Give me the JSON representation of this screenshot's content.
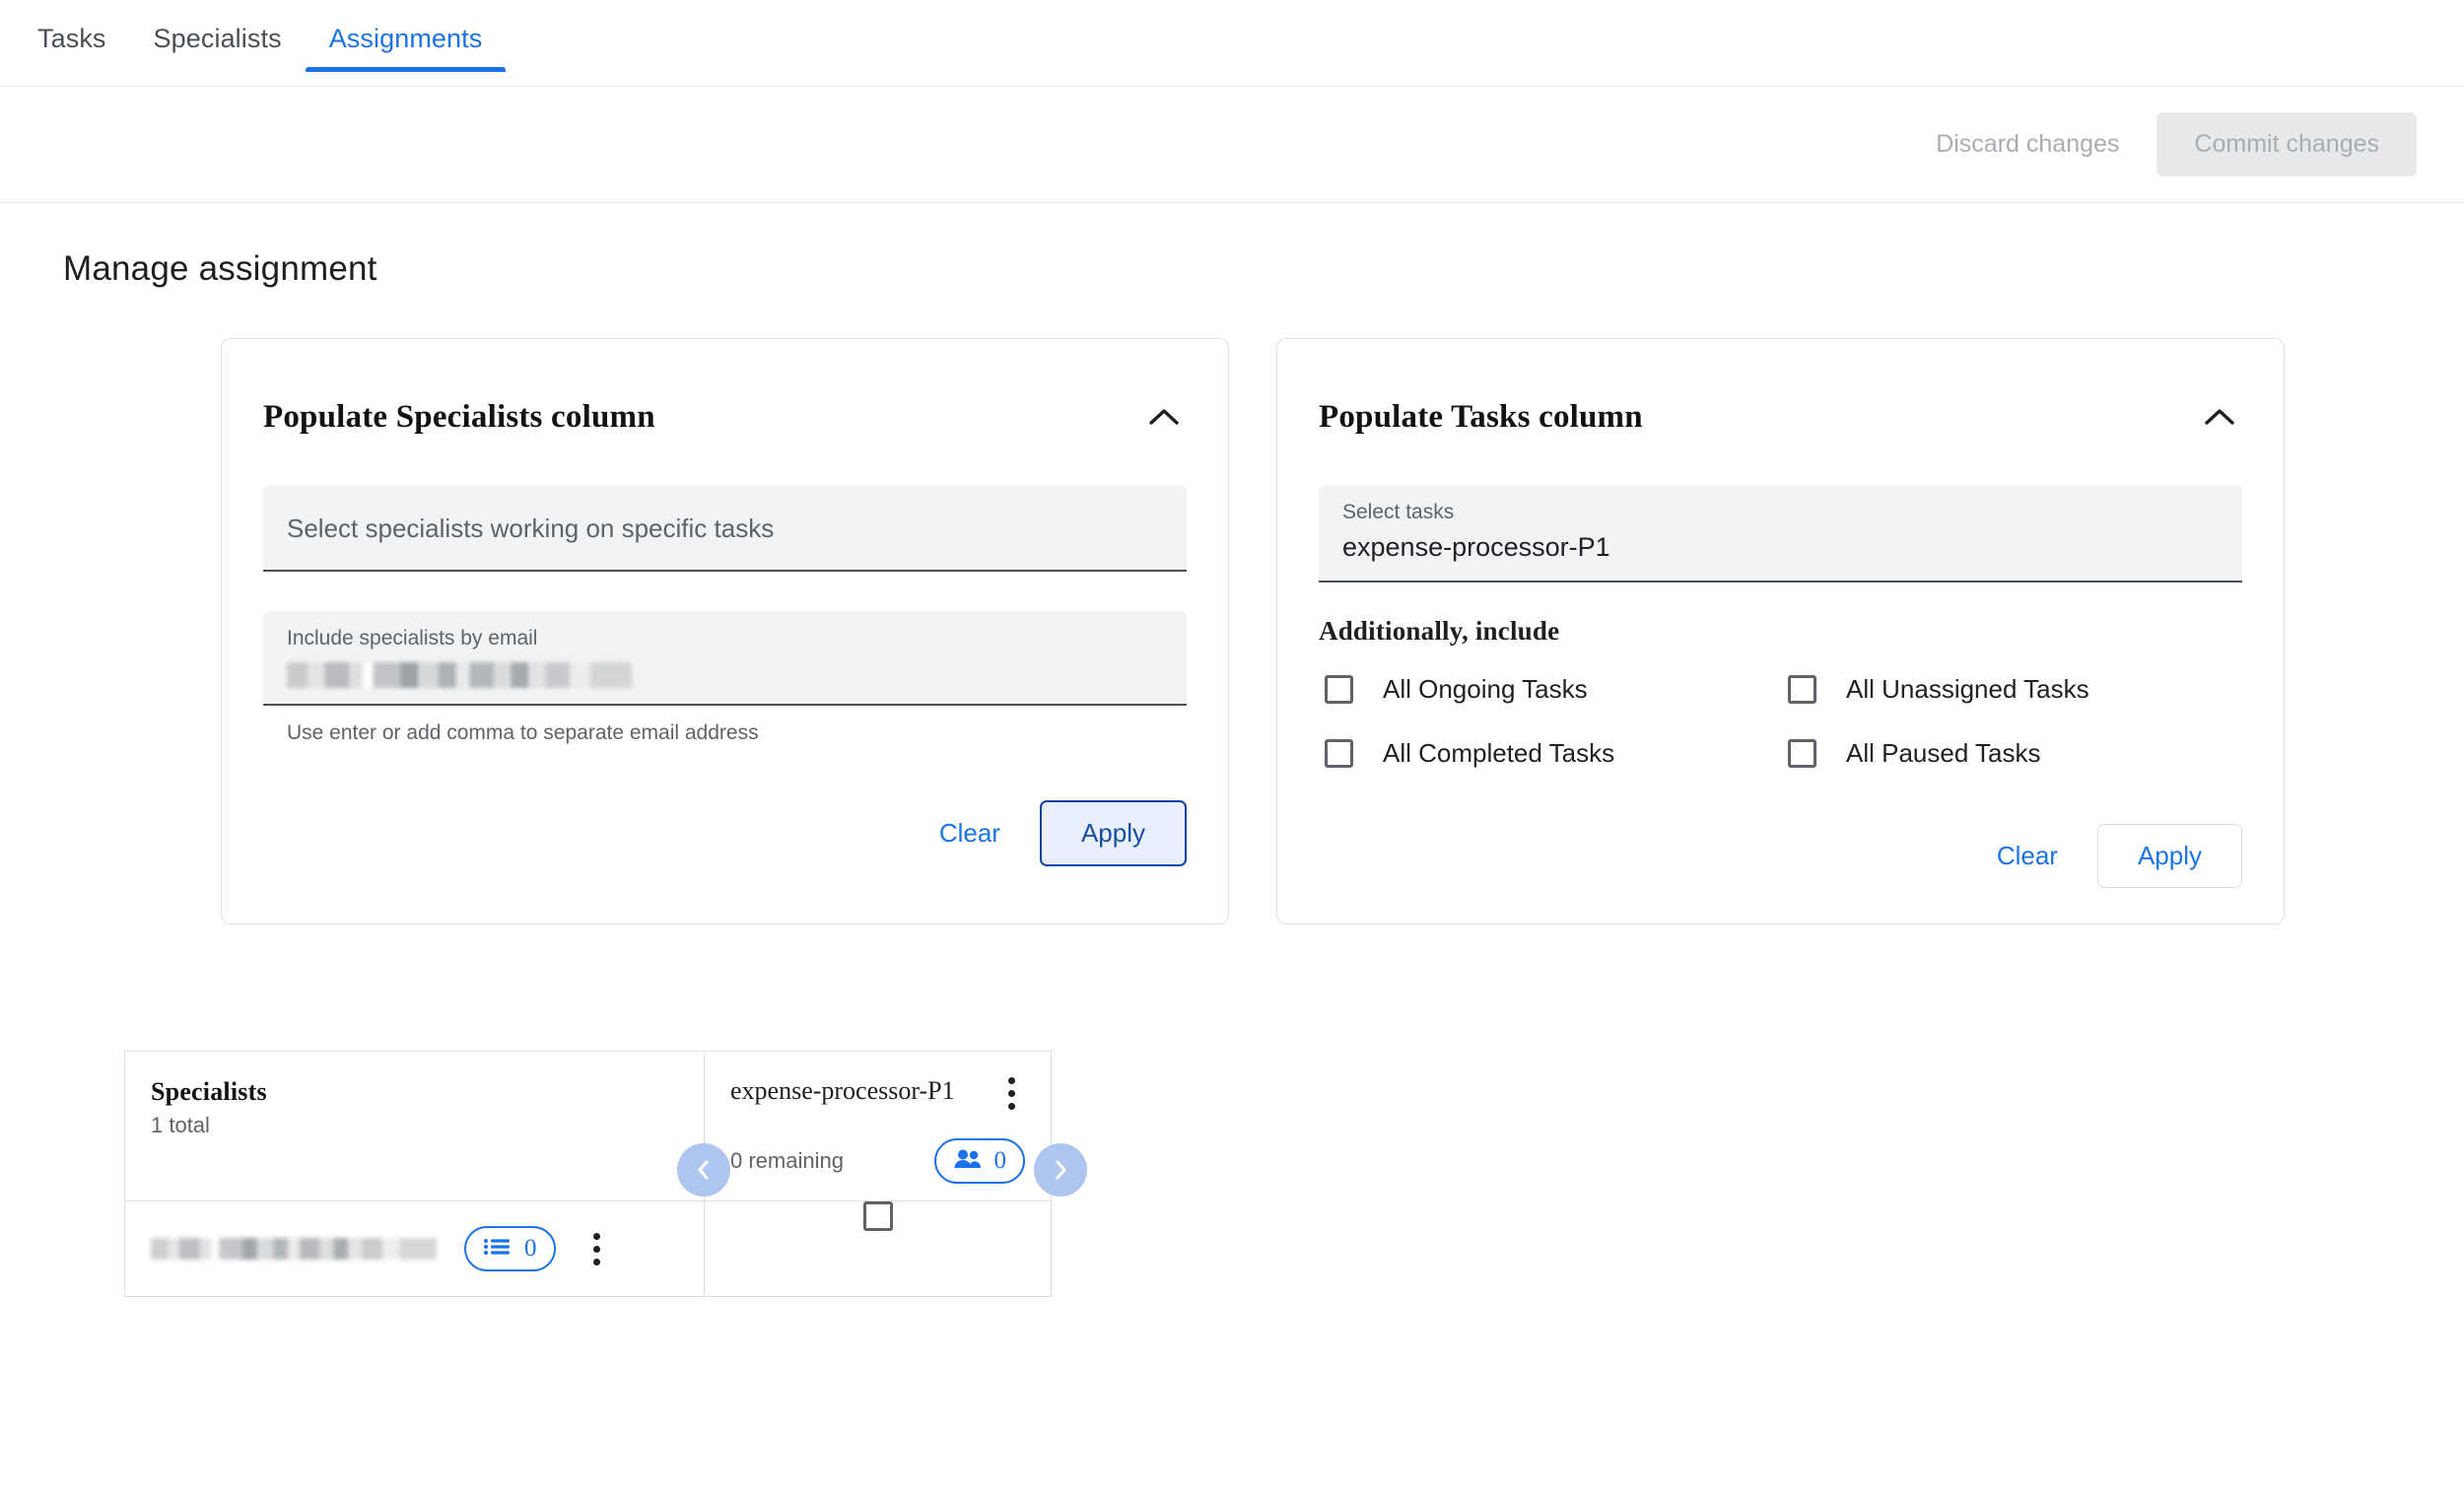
{
  "tabs": [
    {
      "label": "Tasks",
      "active": false
    },
    {
      "label": "Specialists",
      "active": false
    },
    {
      "label": "Assignments",
      "active": true
    }
  ],
  "actionbar": {
    "discard_label": "Discard changes",
    "commit_label": "Commit changes"
  },
  "page": {
    "title": "Manage assignment"
  },
  "specialists_card": {
    "title": "Populate Specialists column",
    "collapse_icon": "chevron-up-icon",
    "select_field": {
      "placeholder": "Select specialists working on specific tasks",
      "value": ""
    },
    "email_field": {
      "label": "Include specialists by email",
      "value": "",
      "redacted": true
    },
    "helper_text": "Use enter or add comma to separate email address",
    "clear_label": "Clear",
    "apply_label": "Apply"
  },
  "tasks_card": {
    "title": "Populate Tasks column",
    "collapse_icon": "chevron-up-icon",
    "select_field": {
      "label": "Select tasks",
      "value": "expense-processor-P1"
    },
    "group_title": "Additionally, include",
    "checkboxes": [
      {
        "label": "All Ongoing Tasks",
        "checked": false
      },
      {
        "label": "All Unassigned Tasks",
        "checked": false
      },
      {
        "label": "All Completed Tasks",
        "checked": false
      },
      {
        "label": "All Paused Tasks",
        "checked": false
      }
    ],
    "clear_label": "Clear",
    "apply_label": "Apply"
  },
  "grid": {
    "specialists_header": {
      "title": "Specialists",
      "subtitle": "1 total"
    },
    "task_header": {
      "name": "expense-processor-P1",
      "remaining": "0 remaining",
      "assignee_count": "0",
      "assignee_icon": "people-icon",
      "menu_icon": "kebab-menu-icon"
    },
    "nav": {
      "prev_icon": "chevron-left-icon",
      "next_icon": "chevron-right-icon"
    },
    "rows": [
      {
        "email": "",
        "email_redacted": true,
        "list_count": "0",
        "list_icon": "list-icon",
        "menu_icon": "kebab-menu-icon",
        "assigned": false
      }
    ]
  },
  "colors": {
    "accent": "#1a73e8",
    "accent_dark": "#174ea6",
    "field_bg": "#f1f3f4",
    "border": "#dcdfe3",
    "muted_text": "#5f6368",
    "nav_circle": "#aec5f0"
  }
}
